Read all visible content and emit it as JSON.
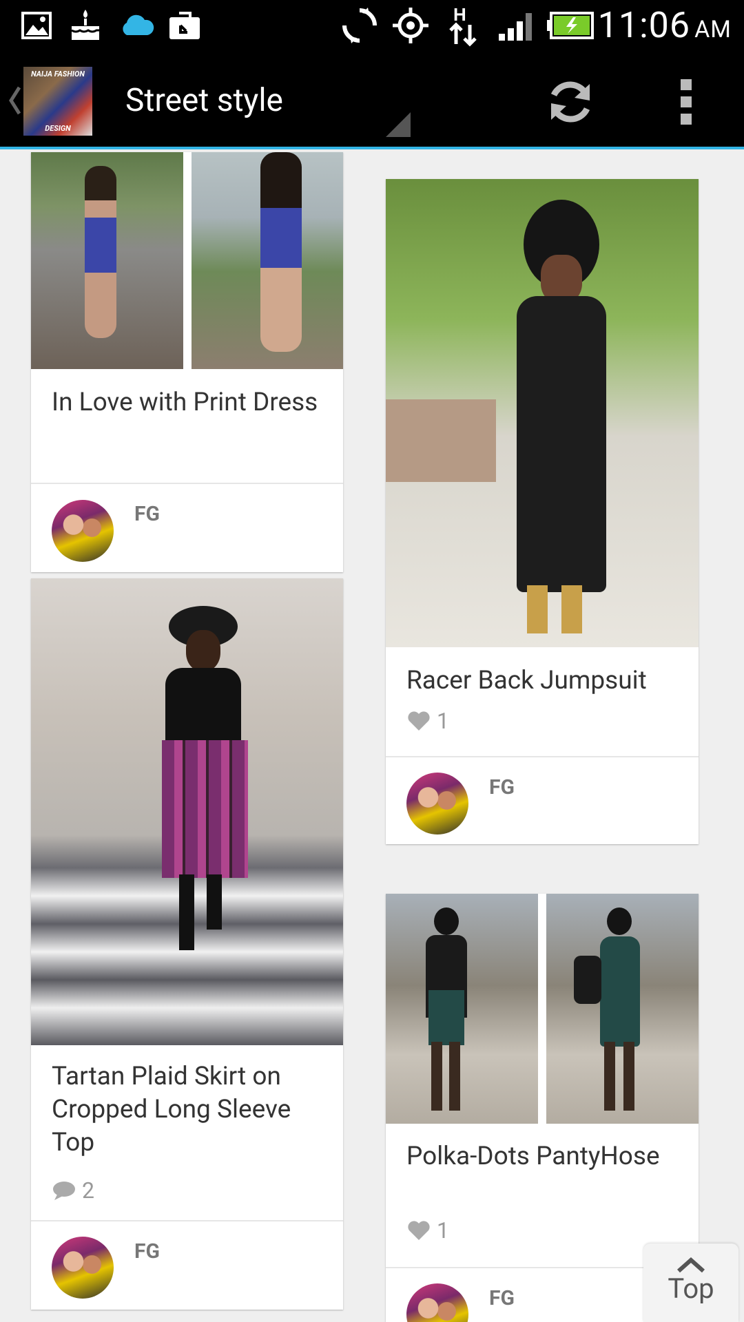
{
  "status_bar": {
    "time": "11:06",
    "ampm": "AM",
    "icons": [
      "gallery-icon",
      "cake-icon",
      "cloud-icon",
      "upload-icon",
      "sync-icon",
      "gps-icon",
      "data-h-icon",
      "signal-icon",
      "battery-icon"
    ]
  },
  "action_bar": {
    "logo_top": "NAIJA FASHION",
    "logo_bottom": "DESIGN",
    "title": "Street style"
  },
  "posts": [
    {
      "title": "In Love with Print Dress",
      "author": "FG"
    },
    {
      "title": "Racer Back Jumpsuit",
      "likes": "1",
      "author": "FG"
    },
    {
      "title": "Tartan Plaid Skirt on Cropped Long Sleeve Top",
      "comments": "2",
      "author": "FG"
    },
    {
      "title": "Polka-Dots PantyHose",
      "likes": "1",
      "author": "FG"
    }
  ],
  "top_button": {
    "label": "Top"
  },
  "colors": {
    "accent": "#33b5e5",
    "background": "#efefef"
  }
}
